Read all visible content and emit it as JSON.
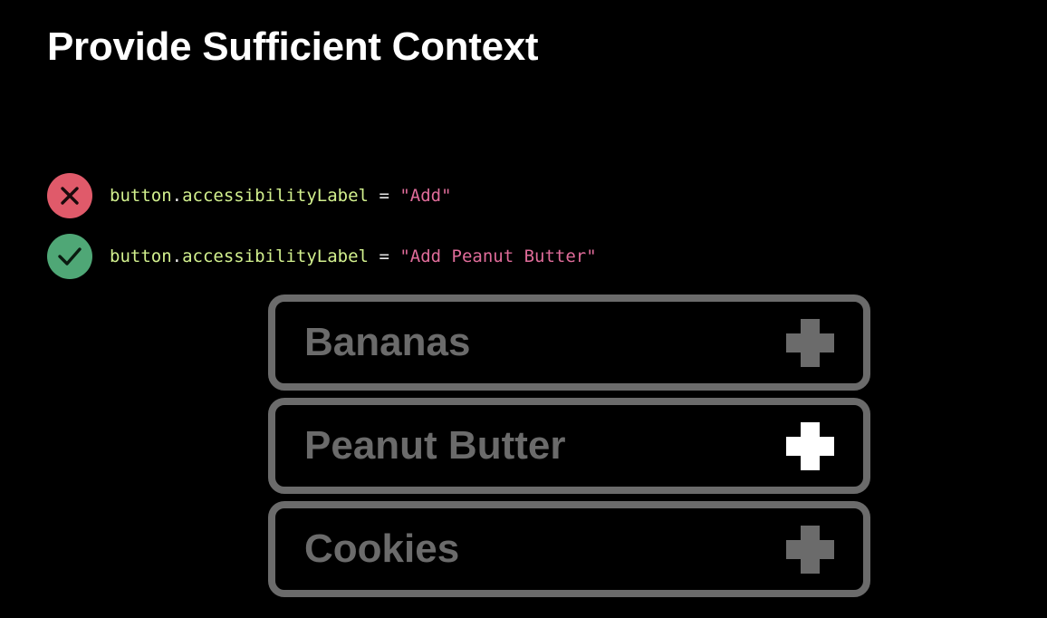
{
  "title": "Provide Sufficient Context",
  "examples": [
    {
      "verdict": "bad",
      "icon": "x-mark-icon",
      "icon_color": "#e05a6a",
      "code": {
        "receiver": "button",
        "dot": ".",
        "property": "accessibilityLabel",
        "operator": " = ",
        "value": "\"Add\""
      }
    },
    {
      "verdict": "good",
      "icon": "checkmark-icon",
      "icon_color": "#4fa776",
      "code": {
        "receiver": "button",
        "dot": ".",
        "property": "accessibilityLabel",
        "operator": " = ",
        "value": "\"Add Peanut Butter\""
      }
    }
  ],
  "items": [
    {
      "label": "Bananas",
      "add_icon": "plus-icon",
      "highlighted": false
    },
    {
      "label": "Peanut Butter",
      "add_icon": "plus-icon",
      "highlighted": true
    },
    {
      "label": "Cookies",
      "add_icon": "plus-icon",
      "highlighted": false
    }
  ],
  "colors": {
    "background": "#000000",
    "title": "#ffffff",
    "code_identifier": "#d2f08e",
    "code_string": "#e06c9a",
    "muted": "#6b6b6b",
    "highlight": "#ffffff"
  }
}
